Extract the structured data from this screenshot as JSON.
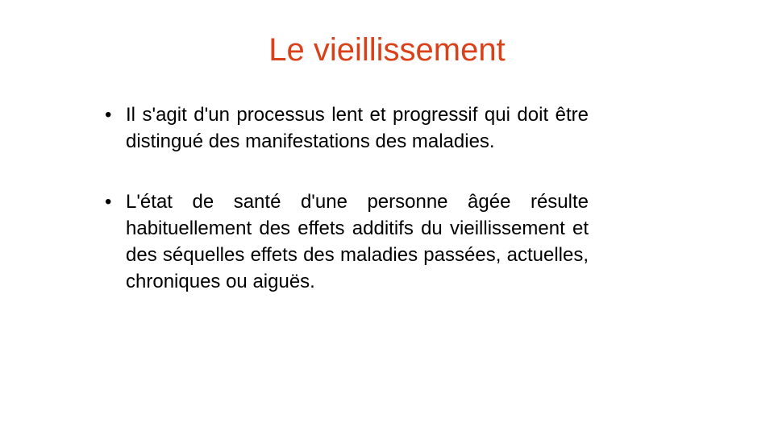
{
  "slide": {
    "title": "Le vieillissement",
    "title_color": "#d9411a",
    "bullet_glyph": "•",
    "bullets": [
      "Il s'agit d'un processus lent et progressif qui doit être distingué des manifestations des maladies.",
      "L'état de santé d'une personne âgée résulte habituellement des effets additifs du vieillissement et des séquelles effets des maladies passées, actuelles, chroniques ou aiguës."
    ]
  }
}
